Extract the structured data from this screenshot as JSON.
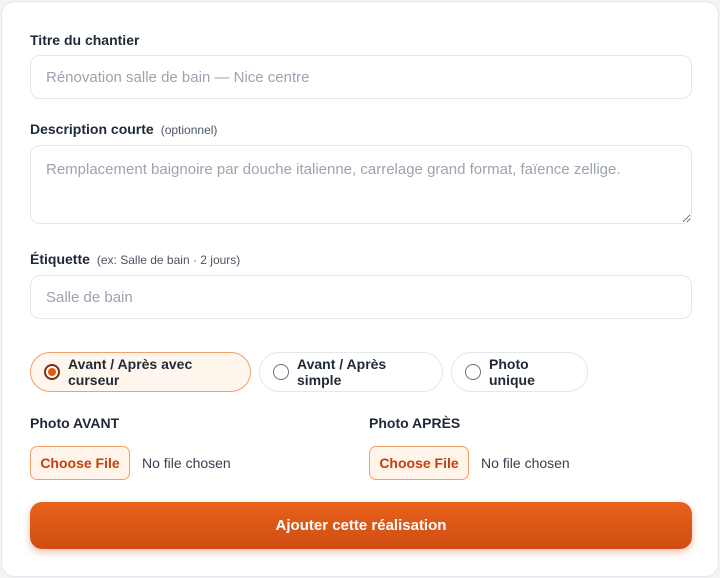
{
  "form": {
    "title_field": {
      "label": "Titre du chantier",
      "placeholder": "Rénovation salle de bain — Nice centre"
    },
    "description_field": {
      "label": "Description courte",
      "hint": "(optionnel)",
      "placeholder": "Remplacement baignoire par douche italienne, carrelage grand format, faïence zellige."
    },
    "tag_field": {
      "label": "Étiquette",
      "hint": "(ex: Salle de bain · 2 jours)",
      "placeholder": "Salle de bain"
    },
    "display_modes": {
      "selected": "Avant / Après avec curseur",
      "options": [
        "Avant / Après avec curseur",
        "Avant / Après simple",
        "Photo unique"
      ]
    },
    "photo_before": {
      "label": "Photo AVANT",
      "button": "Choose File",
      "status": "No file chosen"
    },
    "photo_after": {
      "label": "Photo APRÈS",
      "button": "Choose File",
      "status": "No file chosen"
    },
    "submit_label": "Ajouter cette réalisation"
  },
  "colors": {
    "accent": "#e8621c",
    "accent_dark": "#cf4d12",
    "active_pill_bg": "#fff7ed",
    "border": "#e5e7eb"
  }
}
